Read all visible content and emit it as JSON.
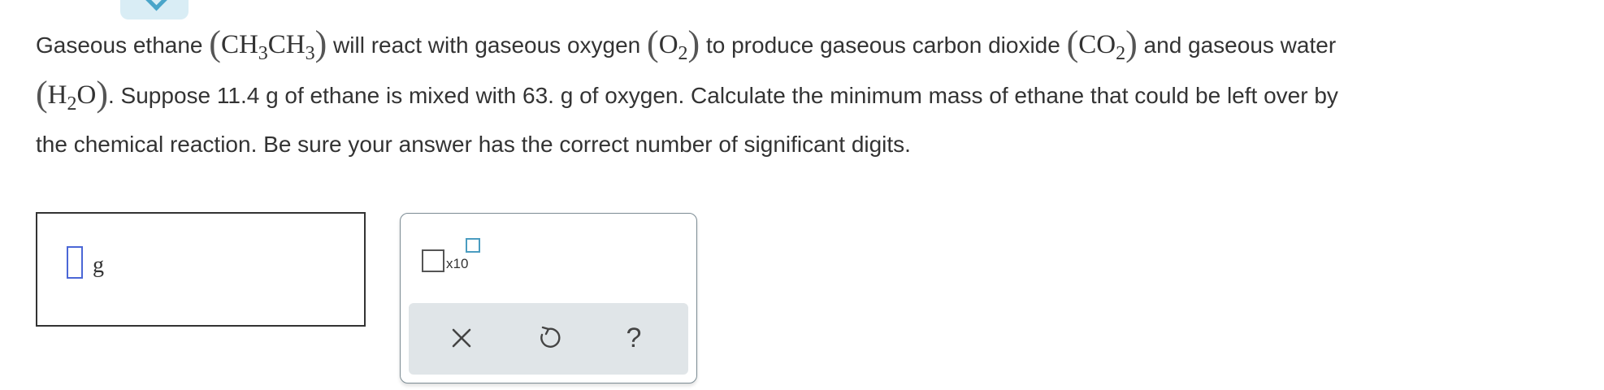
{
  "problem": {
    "line1": {
      "t1": "Gaseous ethane ",
      "ethane_formula": "CH₃CH₃",
      "t2": " will react with gaseous oxygen ",
      "oxygen_formula": "O₂",
      "t3": " to produce gaseous carbon dioxide ",
      "co2_formula": "CO₂",
      "t4": " and gaseous water"
    },
    "line2": {
      "water_formula": "H₂O",
      "t5": ". Suppose 11.4 g of ethane is mixed with 63. g of oxygen. Calculate the minimum mass of ethane that could be left over by"
    },
    "line3": "the chemical reaction. Be sure your answer has the correct number of significant digits."
  },
  "answer": {
    "value": "",
    "unit": "g"
  },
  "tools": {
    "sci_notation_label": "x10",
    "clear_icon": "x-icon",
    "undo_icon": "undo-icon",
    "help_icon": "question-icon",
    "help_label": "?"
  },
  "colors": {
    "accent_blue": "#4aa5c9",
    "input_slot": "#4b67d6",
    "panel_bar": "#e0e5e8"
  }
}
